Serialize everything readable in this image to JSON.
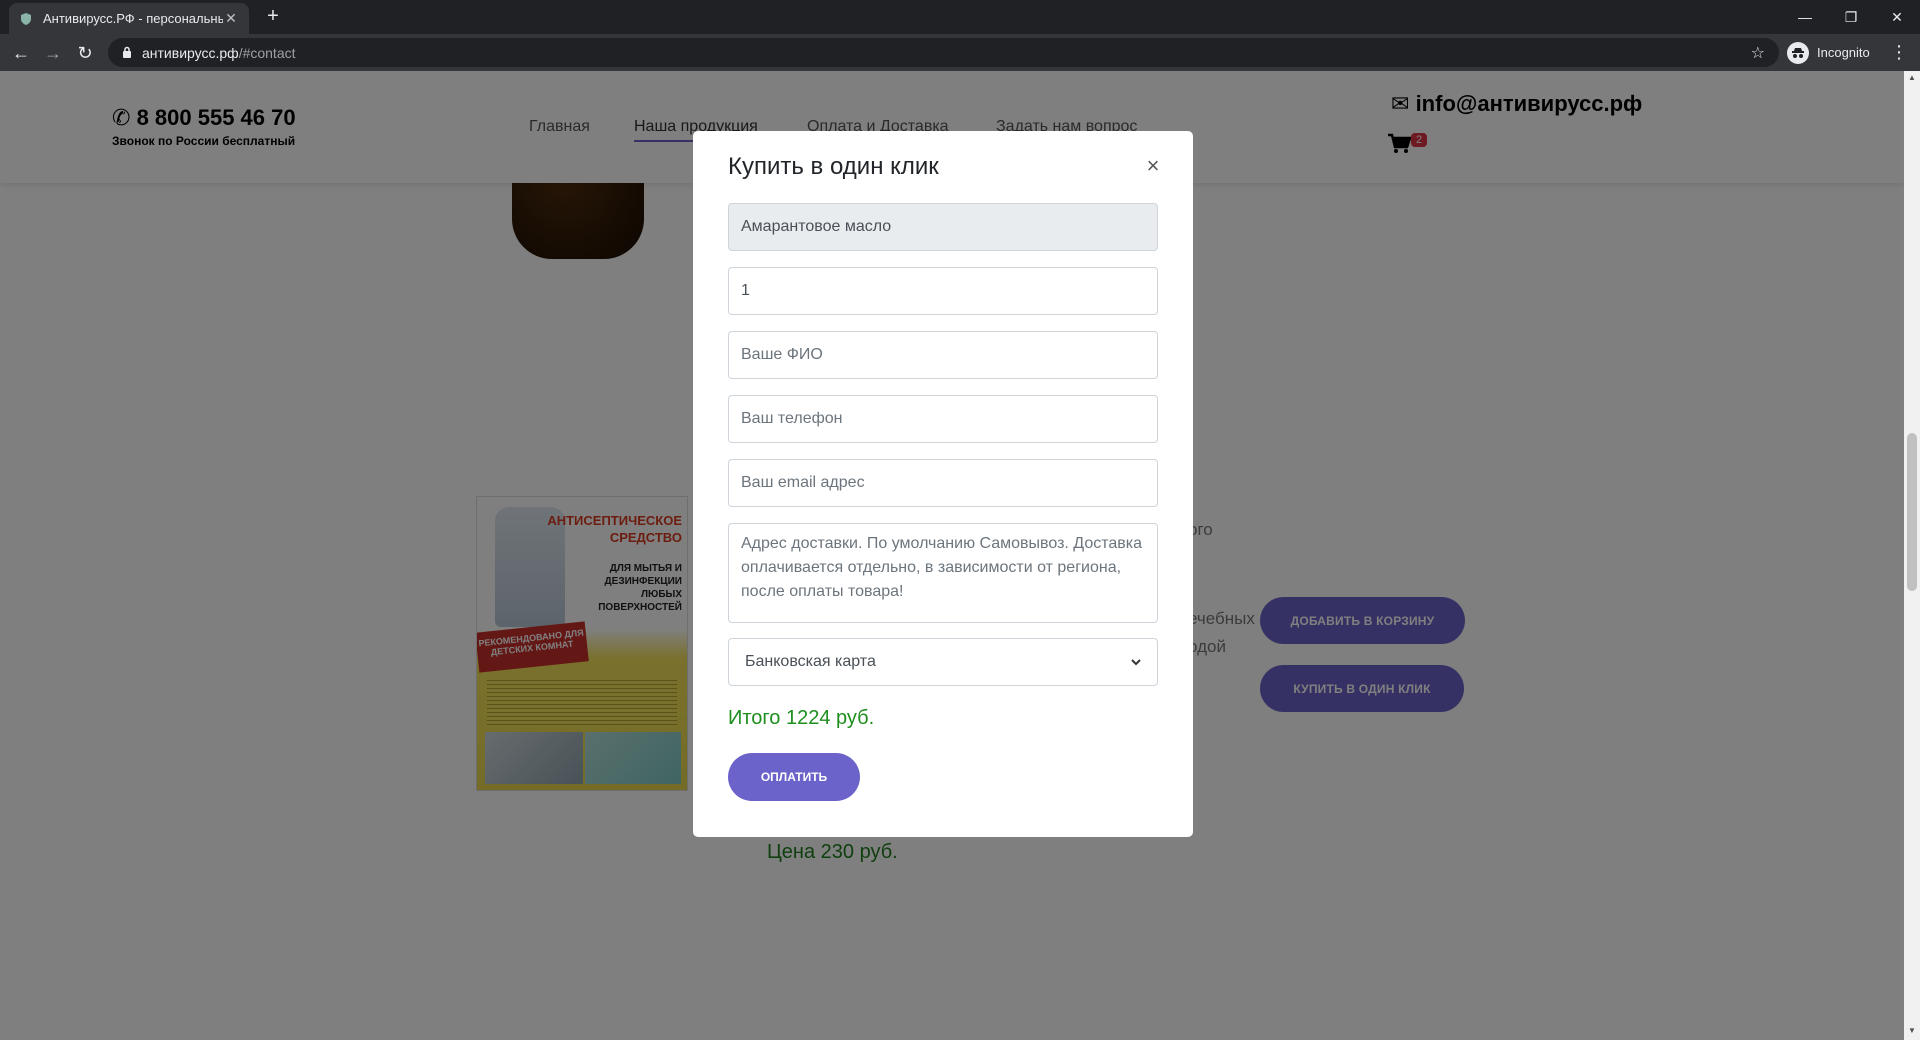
{
  "browser": {
    "tab_title": "Антивирусс.РФ - персональные",
    "url_host": "антивирусс.рф",
    "url_path": "/#contact",
    "incognito_label": "Incognito"
  },
  "site": {
    "phone": "8 800 555 46 70",
    "phone_note": "Звонок по России бесплатный",
    "nav": [
      "Главная",
      "Наша продукция",
      "Оплата и Доставка",
      "Задать нам вопрос"
    ],
    "email": "info@антивирусс.рф",
    "cart_count": "2"
  },
  "background": {
    "poster_title": "АНТИСЕПТИЧЕСКОЕ СРЕДСТВО",
    "poster_subtitle": "ДЛЯ МЫТЬЯ И ДЕЗИНФЕКЦИИ ЛЮБЫХ ПОВЕРХНОСТЕЙ",
    "poster_ribbon": "РЕКОМЕНДОВАНО ДЛЯ ДЕТСКИХ КОМНАТ",
    "frag1": ",",
    "frag2": "ого",
    "frag3": "ечебных",
    "frag4": "одой",
    "add_to_cart": "ДОБАВИТЬ В КОРЗИНУ",
    "buy_one_click": "КУПИТЬ В ОДИН КЛИК",
    "price": "Цена 230 руб."
  },
  "modal": {
    "title": "Купить в один клик",
    "close": "×",
    "product": "Амарантовое масло",
    "quantity": "1",
    "name_placeholder": "Ваше ФИО",
    "phone_placeholder": "Ваш телефон",
    "email_placeholder": "Ваш email адрес",
    "address_placeholder": "Адрес доставки. По умолчанию Самовывоз. Доставка оплачивается отдельно, в зависимости от региона, после оплаты товара!",
    "payment_method": "Банковская карта",
    "total": "Итого 1224 руб.",
    "pay_button": "ОПЛАТИТЬ"
  },
  "colors": {
    "accent": "#6b63c9",
    "price_green": "#1e8f1e"
  }
}
